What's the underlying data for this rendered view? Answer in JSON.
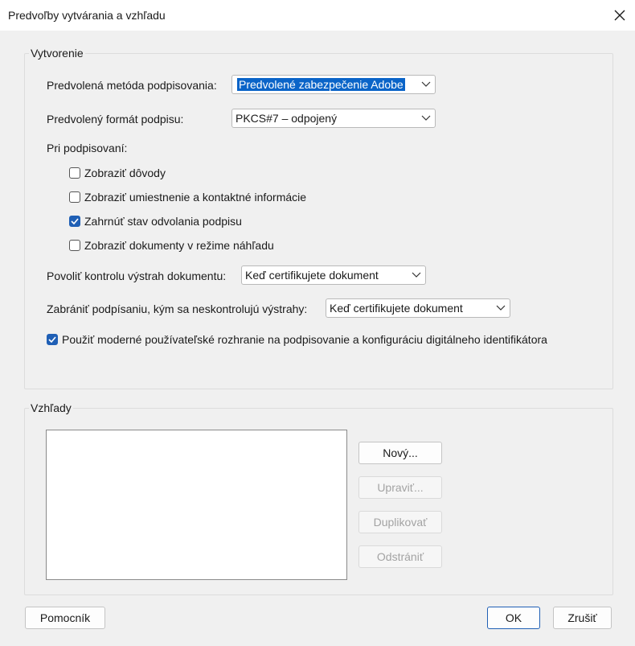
{
  "window": {
    "title": "Predvoľby vytvárania a vzhľadu"
  },
  "creation": {
    "group_label": "Vytvorenie",
    "method_label": "Predvolená metóda podpisovania:",
    "method_value": "Predvolené zabezpečenie Adobe",
    "format_label": "Predvolený formát podpisu:",
    "format_value": "PKCS#7 – odpojený",
    "when_signing_label": "Pri podpisovaní:",
    "checkboxes": [
      {
        "label": "Zobraziť dôvody",
        "checked": false
      },
      {
        "label": "Zobraziť umiestnenie a kontaktné informácie",
        "checked": false
      },
      {
        "label": "Zahrnúť stav odvolania podpisu",
        "checked": true
      },
      {
        "label": "Zobraziť dokumenty v režime náhľadu",
        "checked": false
      }
    ],
    "warnings_label": "Povoliť kontrolu výstrah dokumentu:",
    "warnings_value": "Keď certifikujete dokument",
    "prevent_label": "Zabrániť podpísaniu, kým sa neskontrolujú výstrahy:",
    "prevent_value": "Keď certifikujete dokument",
    "modern_ui_label": "Použiť moderné používateľské rozhranie na podpisovanie a konfiguráciu digitálneho identifikátora",
    "modern_ui_checked": true
  },
  "appearances": {
    "group_label": "Vzhľady",
    "new_button": "Nový...",
    "edit_button": "Upraviť...",
    "duplicate_button": "Duplikovať",
    "remove_button": "Odstrániť"
  },
  "footer": {
    "help_button": "Pomocník",
    "ok_button": "OK",
    "cancel_button": "Zrušiť"
  },
  "colors": {
    "accent": "#1f5fb5",
    "selection": "#0a64c8"
  },
  "icons": {
    "close": "close-icon",
    "dropdown": "chevron-down-icon",
    "check": "checkmark-icon"
  }
}
